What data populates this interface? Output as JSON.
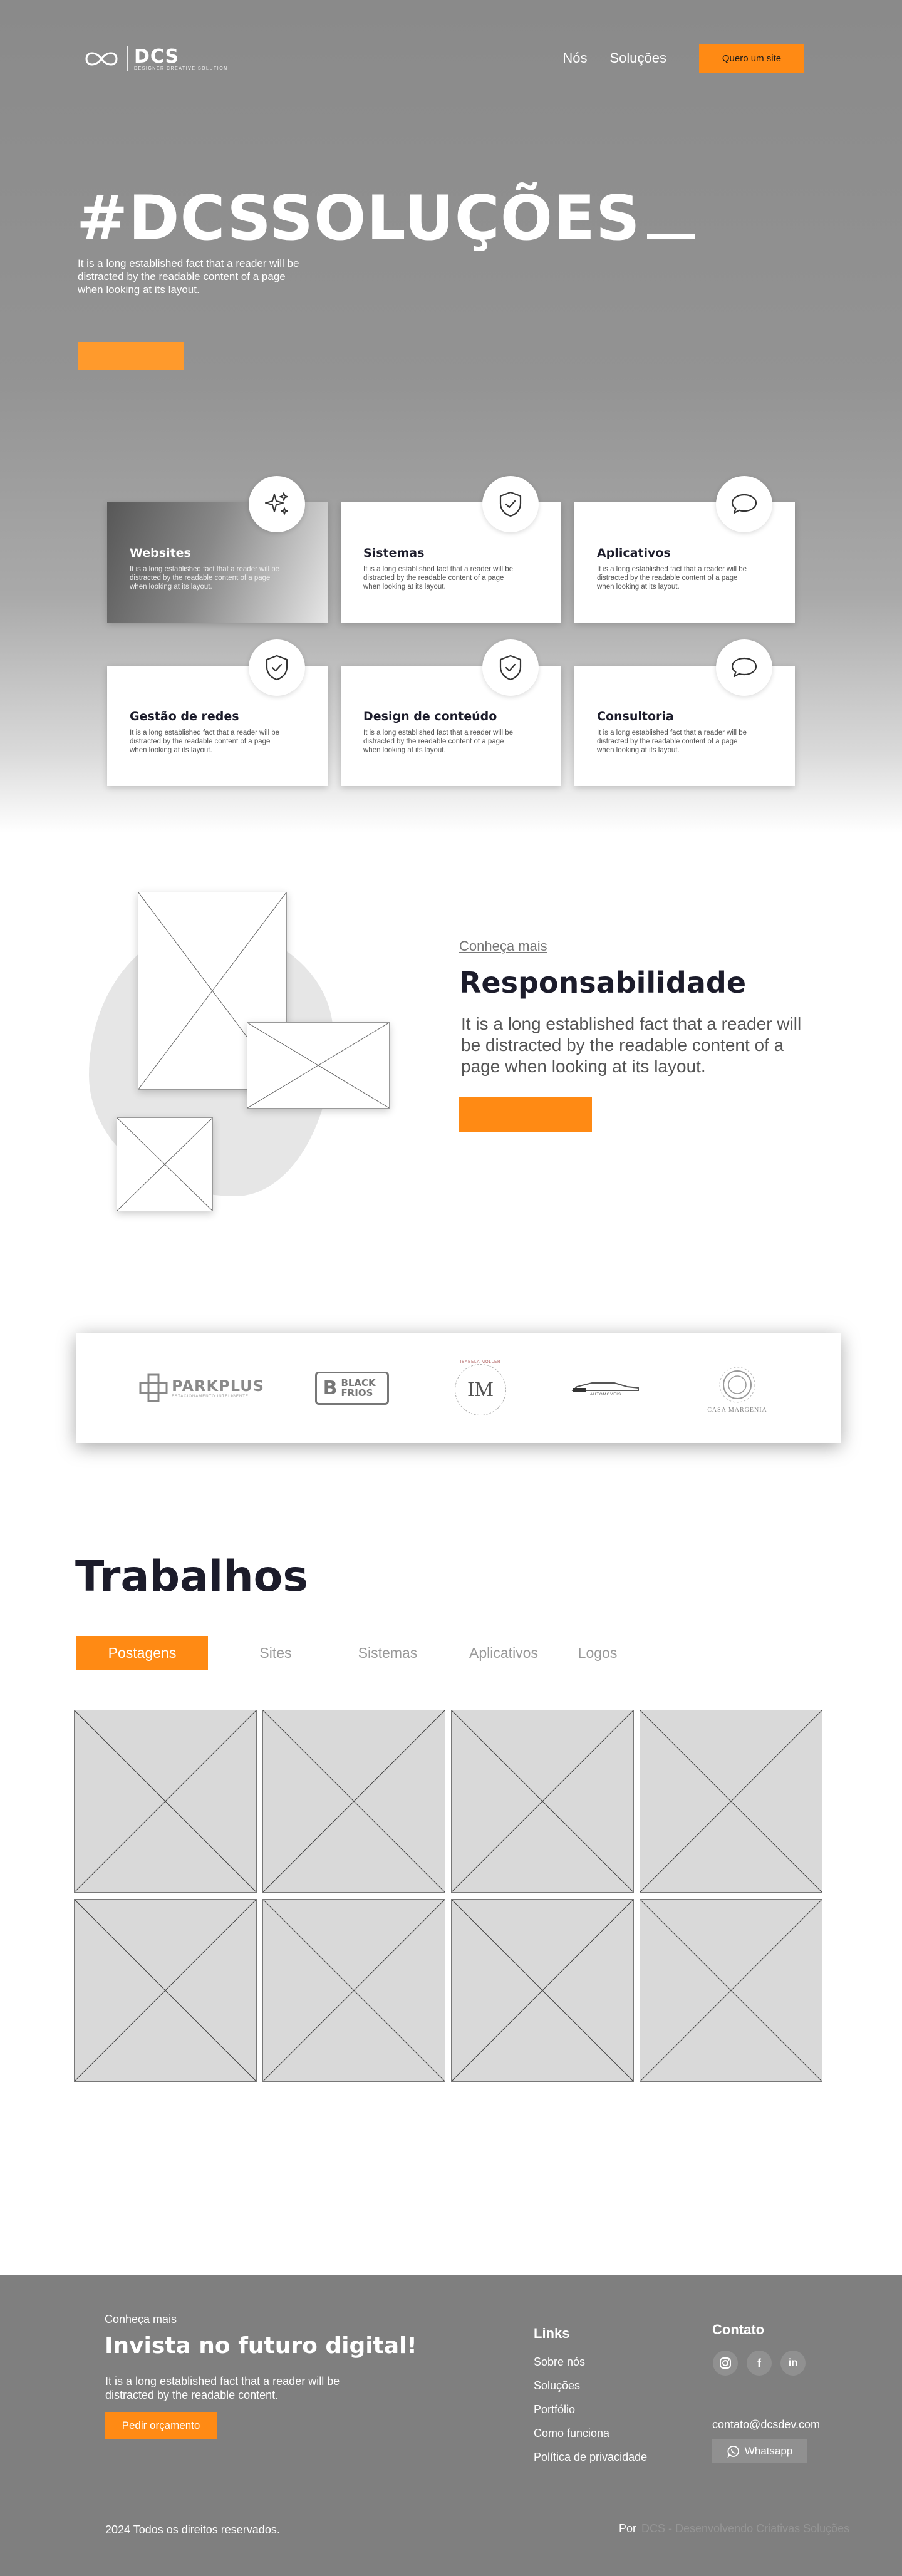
{
  "header": {
    "logo_name": "DCS",
    "logo_tagline": "DESIGNER CREATIVE SOLUTION",
    "nav": [
      "Nós",
      "Soluções"
    ],
    "cta": "Quero um site"
  },
  "hero": {
    "title": "#DCSSOLUÇÕES",
    "subtitle": "It is a long established fact that a reader will be distracted by the readable content of a page when looking at its layout."
  },
  "services": [
    {
      "title": "Websites",
      "text": "It is a long established fact that a reader will be distracted by the readable content of a page when looking at its layout.",
      "icon": "sparkles-icon"
    },
    {
      "title": "Sistemas",
      "text": "It is a long established fact that a reader will be distracted by the readable content of a page when looking at its layout.",
      "icon": "shield-check-icon"
    },
    {
      "title": "Aplicativos",
      "text": "It is a long established fact that a reader will be distracted by the readable content of a page when looking at its layout.",
      "icon": "chat-bubble-icon"
    },
    {
      "title": "Gestão de redes",
      "text": "It is a long established fact that a reader will be distracted by the readable content of a page when looking at its layout.",
      "icon": "shield-check-icon"
    },
    {
      "title": "Design de conteúdo",
      "text": "It is a long established fact that a reader will be distracted by the readable content of a page when looking at its layout.",
      "icon": "shield-check-icon"
    },
    {
      "title": "Consultoria",
      "text": "It is a long established fact that a reader will be distracted by the readable content of a page when looking at its layout.",
      "icon": "chat-bubble-icon"
    }
  ],
  "responsibility": {
    "link": "Conheça mais",
    "title": "Responsabilidade",
    "text": "It is a long established fact that a reader will be distracted by the readable content of a page when looking at its layout."
  },
  "clients": [
    {
      "name": "PARKPLUS",
      "sub": "ESTACIONAMENTO INTELIGENTE"
    },
    {
      "name": "BLACK FRIOS",
      "sub": ""
    },
    {
      "name": "IM",
      "sub": "ISABELA MOLLER"
    },
    {
      "name": "AUTOMÓVEIS",
      "sub": ""
    },
    {
      "name": "CASA MARGENIA",
      "sub": ""
    }
  ],
  "works": {
    "title": "Trabalhos",
    "tabs": [
      "Postagens",
      "Sites",
      "Sistemas",
      "Aplicativos",
      "Logos"
    ],
    "active_tab": "Postagens"
  },
  "footer": {
    "link": "Conheça mais",
    "title": "Invista no futuro digital!",
    "text": "It is a long established fact that a reader will be distracted by the readable content.",
    "button": "Pedir orçamento",
    "links_title": "Links",
    "links": [
      "Sobre nós",
      "Soluções",
      "Portfólio",
      "Como funciona",
      "Política de privacidade"
    ],
    "contact_title": "Contato",
    "social_icons": [
      "instagram-icon",
      "facebook-icon",
      "linkedin-icon"
    ],
    "email": "contato@dcsdev.com",
    "whatsapp": "Whatsapp",
    "copyright": "2024 Todos os direitos reservados.",
    "by_label": "Por",
    "by_name": "DCS - Desenvolvendo Criativas Soluções"
  },
  "colors": {
    "accent": "#ff8a14",
    "hero_gray": "#8a8a8a",
    "footer_gray": "#7f7f7f",
    "dark_text": "#1c1c2b"
  }
}
